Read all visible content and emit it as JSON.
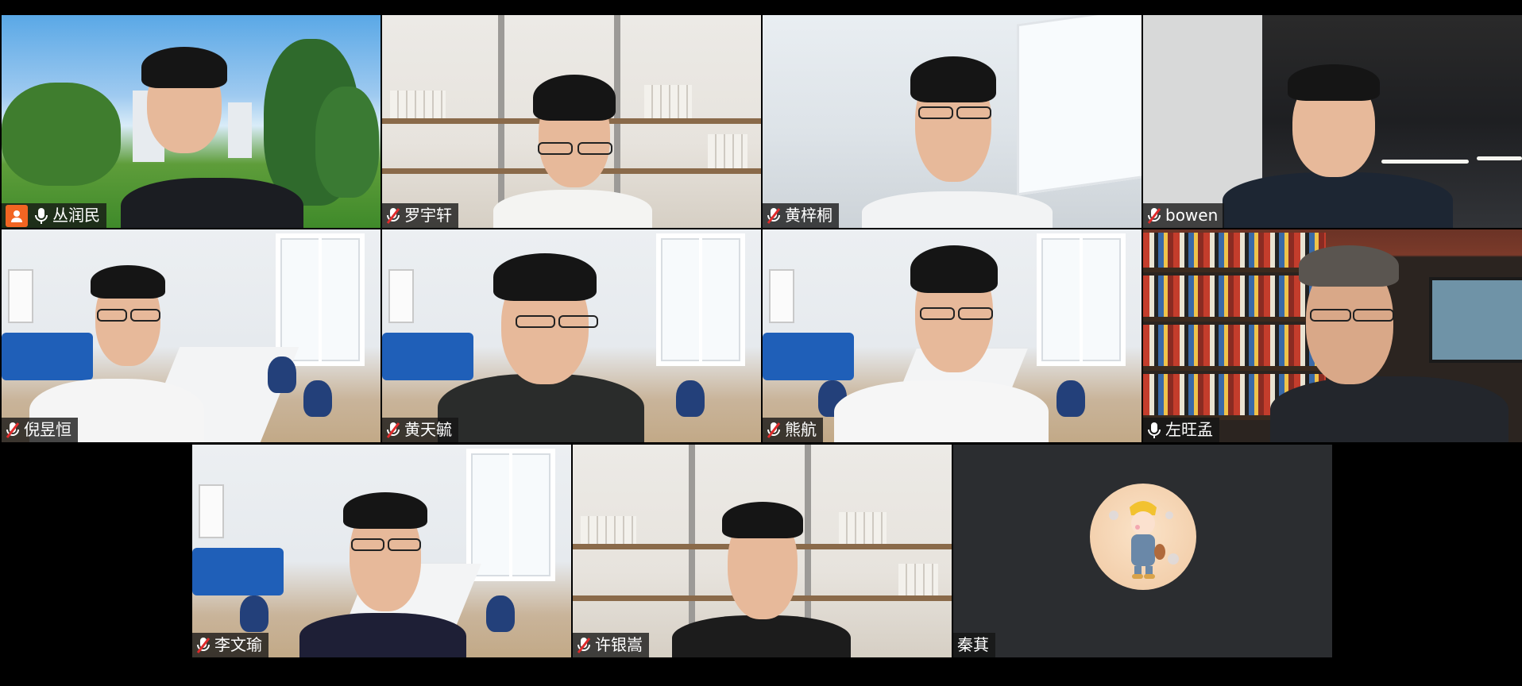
{
  "meeting": {
    "participants": [
      {
        "name": "丛润民",
        "mic": "on",
        "host": true,
        "speaking": true
      },
      {
        "name": "罗宇轩",
        "mic": "muted"
      },
      {
        "name": "黄梓桐",
        "mic": "muted"
      },
      {
        "name": "bowen",
        "mic": "muted"
      },
      {
        "name": "倪昱恒",
        "mic": "muted"
      },
      {
        "name": "黄天毓",
        "mic": "muted"
      },
      {
        "name": "熊航",
        "mic": "muted"
      },
      {
        "name": "左旺孟",
        "mic": "on"
      },
      {
        "name": "李文瑜",
        "mic": "muted"
      },
      {
        "name": "许银嵩",
        "mic": "muted"
      },
      {
        "name": "秦萁",
        "mic": "none",
        "video": "off",
        "avatar": "cartoon-avatar"
      }
    ]
  },
  "icons": {
    "muted": "muted-mic-icon",
    "on": "mic-icon",
    "host": "person-badge-icon"
  },
  "colors": {
    "background": "#000000",
    "label_bg": "#141414",
    "host_badge": "#f26522",
    "muted_red": "#e02b2b",
    "active_speaker": "#2ecc40",
    "empty_tile": "#2b2d30"
  }
}
